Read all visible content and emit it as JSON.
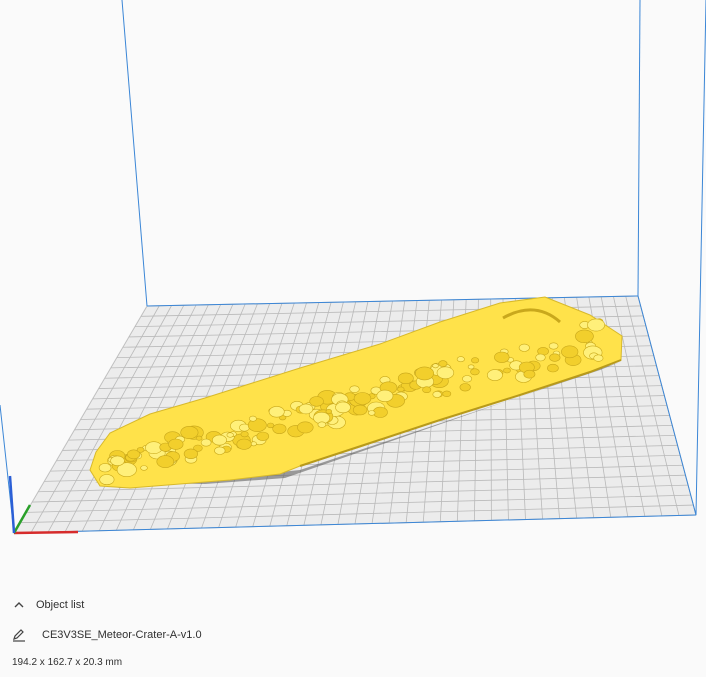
{
  "object_panel": {
    "object_list_label": "Object list",
    "object_name": "CE3V3SE_Meteor-Crater-A-v1.0",
    "dimensions": "194.2 x 162.7 x 20.3 mm"
  },
  "icons": {
    "collapse": "chevron-up-icon",
    "edit": "pencil-icon"
  },
  "colors": {
    "model": "#ffe24a",
    "model_shade": "#d8b92a",
    "build_plate": "#e8e8e8",
    "grid_line": "#b9b9b9",
    "volume_edge": "#3b86d6",
    "axis_x": "#d62b2b",
    "axis_y": "#2aa02a",
    "axis_z": "#2b5fd6"
  }
}
